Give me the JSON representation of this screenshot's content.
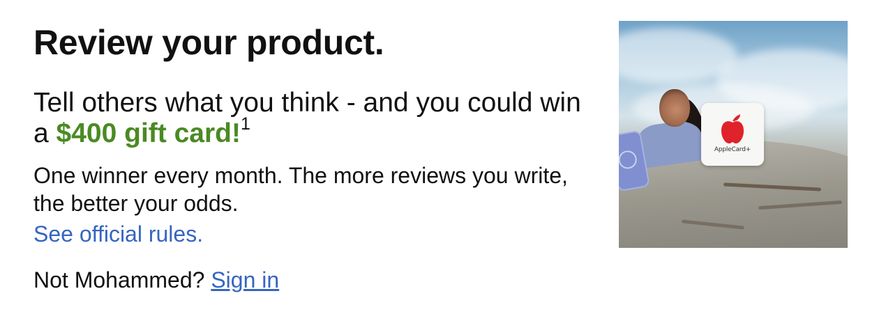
{
  "header": {
    "title": "Review your product."
  },
  "promo": {
    "text_before": "Tell others what you think - and you could win a ",
    "amount": "$400 gift card!",
    "footnote": "1",
    "amount_color": "#4a8a23"
  },
  "description": "One winner every month. The more reviews you write, the better your odds.",
  "rules_link": "See official rules.",
  "account": {
    "prompt": "Not Mohammed?",
    "sign_in_link": "Sign in"
  },
  "image": {
    "alt": "Person holding phone next to Apple gift card on a rock",
    "card_text": "AppleCard+"
  },
  "colors": {
    "link": "#3665c1",
    "text": "#111111"
  }
}
